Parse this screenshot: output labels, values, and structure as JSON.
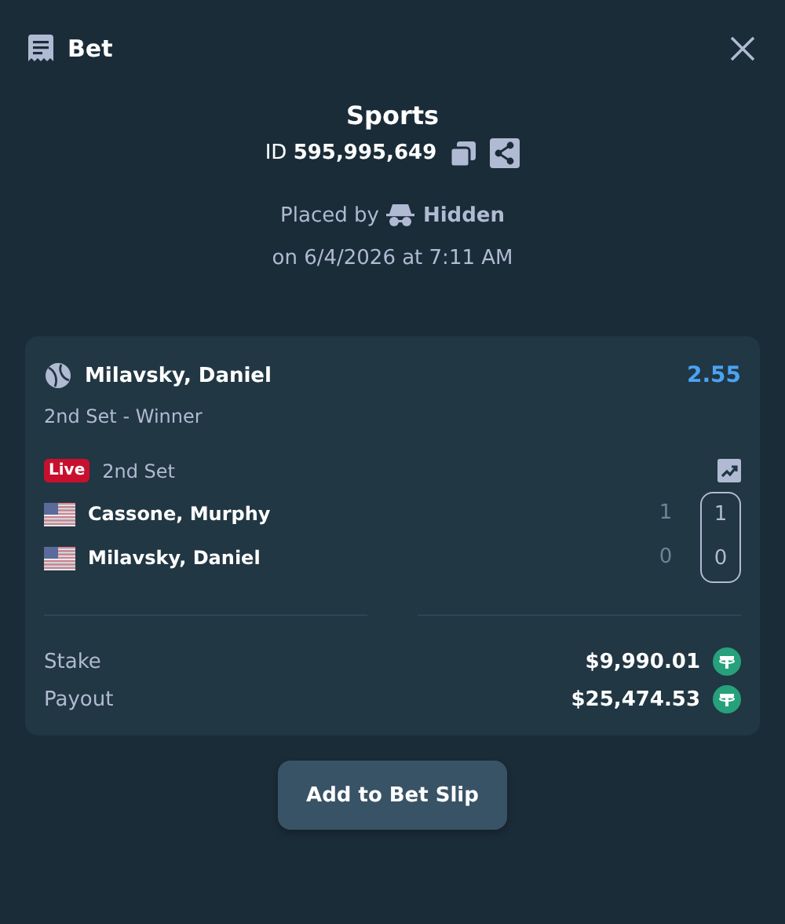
{
  "header": {
    "title": "Bet"
  },
  "summary": {
    "title": "Sports",
    "id_label": "ID",
    "id_value": "595,995,649",
    "placed_by": "Placed by",
    "user": "Hidden",
    "date": "on 6/4/2026 at 7:11 AM"
  },
  "bet": {
    "selection": "Milavsky, Daniel",
    "odds": "2.55",
    "market": "2nd Set - Winner",
    "live_badge": "Live",
    "period": "2nd Set",
    "players": [
      {
        "name": "Cassone, Murphy",
        "scores": [
          {
            "value": "1",
            "current": false
          },
          {
            "value": "1",
            "current": true
          }
        ]
      },
      {
        "name": "Milavsky, Daniel",
        "scores": [
          {
            "value": "0",
            "current": false
          },
          {
            "value": "0",
            "current": true
          }
        ]
      }
    ],
    "totals": [
      {
        "label": "Stake",
        "amount": "$9,990.01"
      },
      {
        "label": "Payout",
        "amount": "$25,474.53"
      }
    ]
  },
  "button": "Add to Bet Slip"
}
